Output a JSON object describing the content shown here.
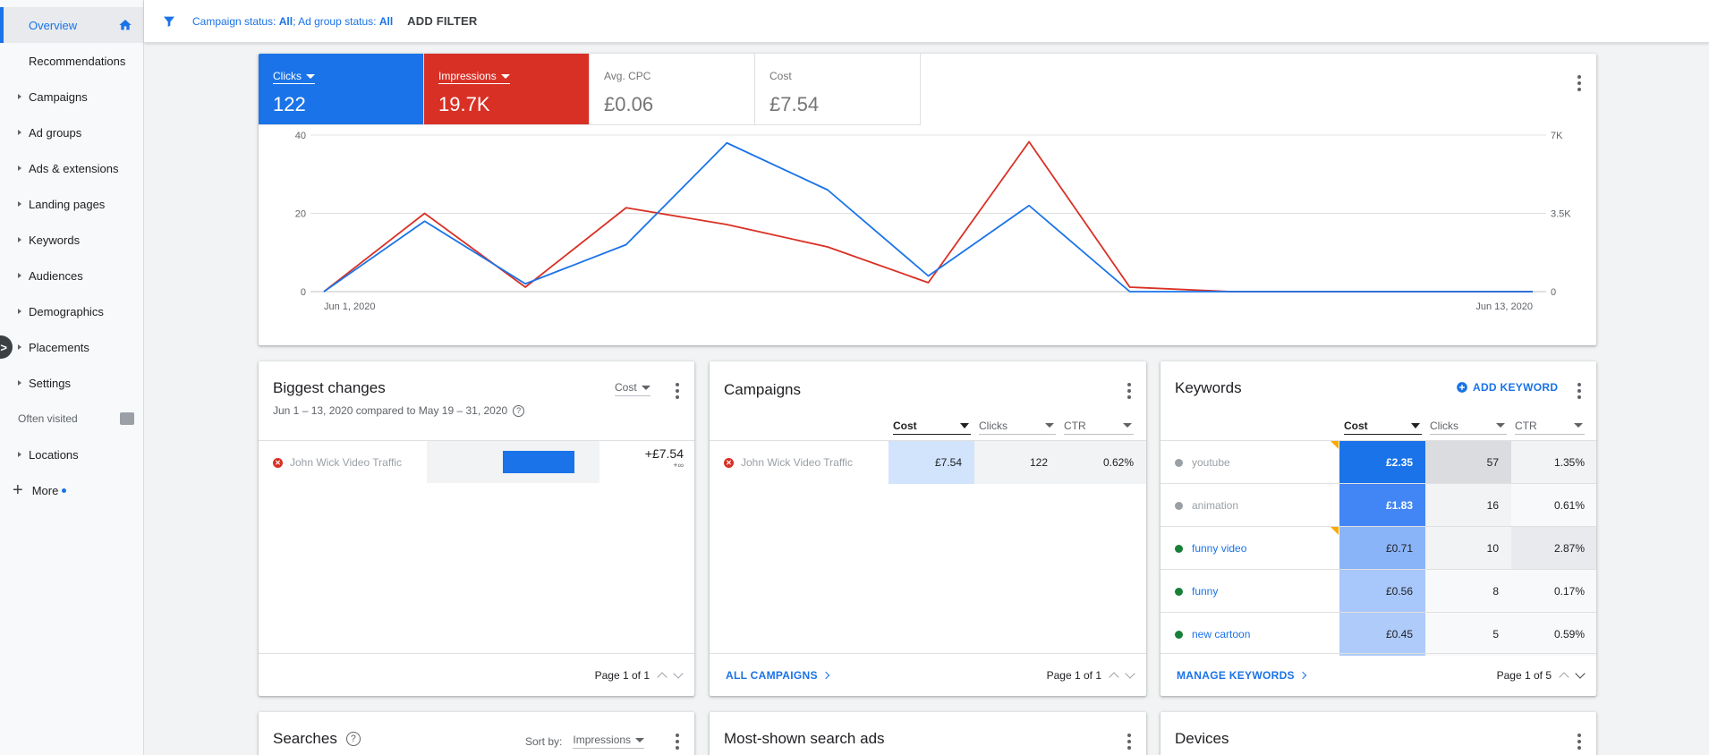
{
  "sidebar": {
    "items": [
      {
        "label": "Overview",
        "active": true
      },
      {
        "label": "Recommendations"
      },
      {
        "label": "Campaigns"
      },
      {
        "label": "Ad groups"
      },
      {
        "label": "Ads & extensions"
      },
      {
        "label": "Landing pages"
      },
      {
        "label": "Keywords"
      },
      {
        "label": "Audiences"
      },
      {
        "label": "Demographics"
      },
      {
        "label": "Placements"
      },
      {
        "label": "Settings"
      }
    ],
    "often_visited": "Often visited",
    "locations": "Locations",
    "more": "More"
  },
  "topbar": {
    "campaign_status_label": "Campaign status: ",
    "campaign_status_value": "All",
    "separator": "; ",
    "adgroup_status_label": "Ad group status: ",
    "adgroup_status_value": "All",
    "add_filter": "ADD FILTER"
  },
  "metrics": [
    {
      "label": "Clicks",
      "value": "122",
      "color": "#1a73e8"
    },
    {
      "label": "Impressions",
      "value": "19.7K",
      "color": "#d93025"
    },
    {
      "label": "Avg. CPC",
      "value": "£0.06"
    },
    {
      "label": "Cost",
      "value": "£7.54"
    }
  ],
  "chart_data": {
    "type": "line",
    "x": [
      "Jun 1, 2020",
      "Jun 2, 2020",
      "Jun 3, 2020",
      "Jun 4, 2020",
      "Jun 5, 2020",
      "Jun 6, 2020",
      "Jun 7, 2020",
      "Jun 8, 2020",
      "Jun 9, 2020",
      "Jun 10, 2020",
      "Jun 11, 2020",
      "Jun 12, 2020",
      "Jun 13, 2020"
    ],
    "x_tick_labels": [
      "Jun 1, 2020",
      "Jun 13, 2020"
    ],
    "series": [
      {
        "name": "Clicks",
        "axis": "left",
        "color": "#1a73e8",
        "values": [
          0,
          18,
          2,
          12,
          38,
          26,
          4,
          22,
          0,
          0,
          0,
          0,
          0
        ]
      },
      {
        "name": "Impressions",
        "axis": "right",
        "color": "#d93025",
        "values": [
          0,
          3500,
          200,
          3750,
          3000,
          2000,
          400,
          6700,
          200,
          0,
          0,
          0,
          0
        ]
      }
    ],
    "y_left": {
      "ticks": [
        "40",
        "20",
        "0"
      ],
      "ylim": [
        0,
        40
      ]
    },
    "y_right": {
      "ticks": [
        "7K",
        "3.5K",
        "0"
      ],
      "ylim": [
        0,
        7000
      ]
    },
    "grid": true
  },
  "biggest_changes": {
    "title": "Biggest changes",
    "subtitle": "Jun 1 – 13, 2020 compared to May 19 – 31, 2020",
    "metric_select": "Cost",
    "row": {
      "name": "John Wick Video Traffic",
      "change": "+£7.54",
      "change_pct": "+∞",
      "bar_fraction": 1.0
    },
    "pager": "Page 1 of 1"
  },
  "campaigns": {
    "title": "Campaigns",
    "columns": [
      "Cost",
      "Clicks",
      "CTR"
    ],
    "rows": [
      {
        "name": "John Wick Video Traffic",
        "cost": "£7.54",
        "clicks": "122",
        "ctr": "0.62%"
      }
    ],
    "footer_link": "ALL CAMPAIGNS",
    "pager": "Page 1 of 1"
  },
  "keywords": {
    "title": "Keywords",
    "add_label": "ADD KEYWORD",
    "columns": [
      "Cost",
      "Clicks",
      "CTR"
    ],
    "rows": [
      {
        "name": "youtube",
        "status_color": "#9aa0a6",
        "cost": "£2.35",
        "clicks": "57",
        "ctr": "1.35%",
        "flag": true
      },
      {
        "name": "animation",
        "status_color": "#9aa0a6",
        "cost": "£1.83",
        "clicks": "16",
        "ctr": "0.61%",
        "flag": false
      },
      {
        "name": "funny video",
        "status_color": "#188038",
        "cost": "£0.71",
        "clicks": "10",
        "ctr": "2.87%",
        "flag": true
      },
      {
        "name": "funny",
        "status_color": "#188038",
        "cost": "£0.56",
        "clicks": "8",
        "ctr": "0.17%",
        "flag": false
      },
      {
        "name": "new cartoon",
        "status_color": "#188038",
        "cost": "£0.45",
        "clicks": "5",
        "ctr": "0.59%",
        "flag": false
      }
    ],
    "footer_link": "MANAGE KEYWORDS",
    "pager": "Page 1 of 5"
  },
  "bottom_cards": {
    "searches": {
      "title": "Searches",
      "sort_label": "Sort by:",
      "sort_value": "Impressions"
    },
    "search_ads": {
      "title": "Most-shown search ads"
    },
    "devices": {
      "title": "Devices"
    }
  }
}
